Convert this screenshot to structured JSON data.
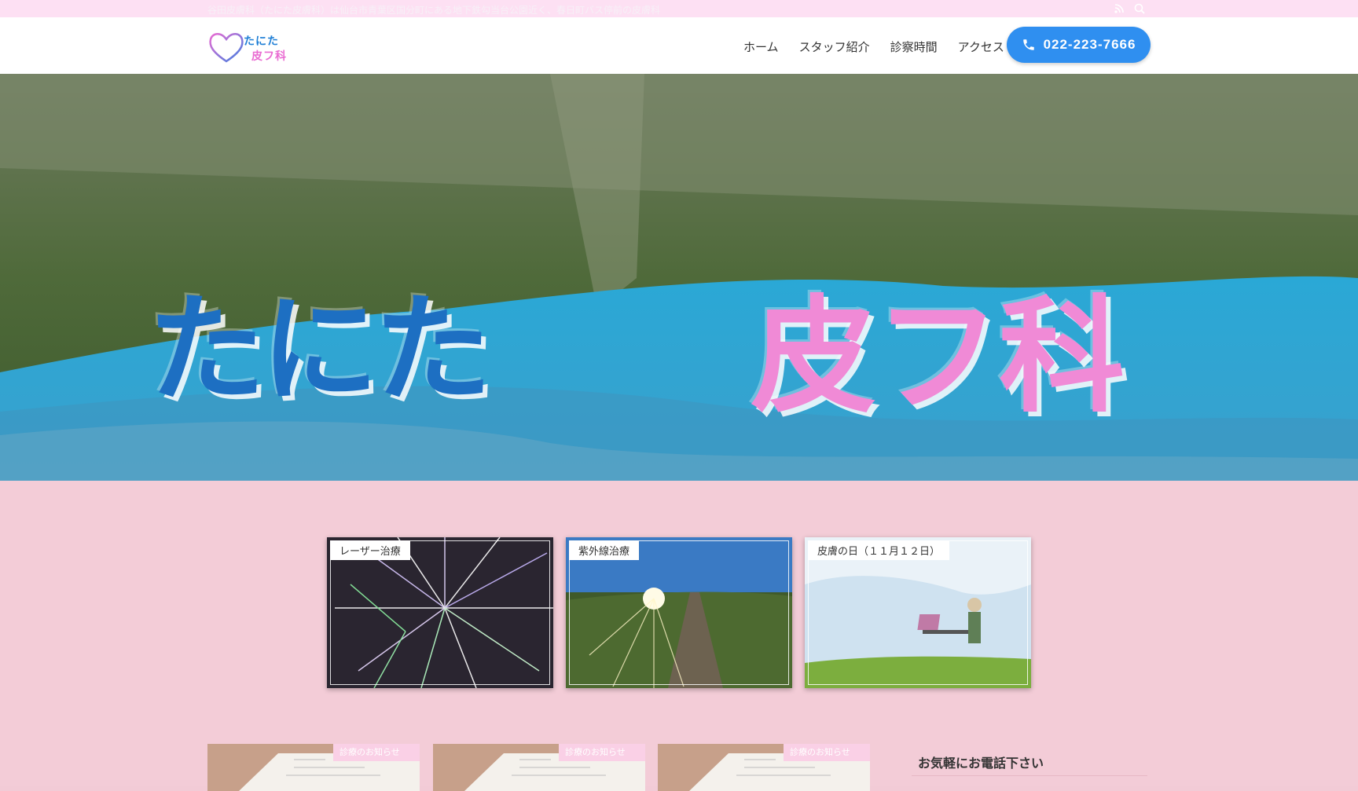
{
  "topbar": {
    "notice": "谷田皮膚科（たにた皮膚科）は仙台市青葉区国分町にある地下鉄勾当台公園近く、春日町バス停前の皮膚科",
    "icons": [
      "rss-icon",
      "search-icon"
    ]
  },
  "header": {
    "logo_line1": "たにた",
    "logo_line2": "皮フ科",
    "nav": [
      "ホーム",
      "スタッフ紹介",
      "診察時間",
      "アクセス"
    ],
    "phone": "022-223-7666"
  },
  "hero": {
    "title_part1": "たにた",
    "title_part2": "皮フ科"
  },
  "features": [
    {
      "label": "レーザー治療"
    },
    {
      "label": "紫外線治療"
    },
    {
      "label": "皮膚の日（１１月１２日）"
    }
  ],
  "posts": [
    {
      "category": "診療のお知らせ"
    },
    {
      "category": "診療のお知らせ"
    },
    {
      "category": "診療のお知らせ"
    }
  ],
  "sidebar": {
    "widget_title": "お気軽にお電話下さい"
  },
  "colors": {
    "accent": "#2f8ff0",
    "brand_pink": "#e96bd2",
    "brand_blue": "#1f7fd6",
    "background_pink": "#f3ccd7"
  }
}
